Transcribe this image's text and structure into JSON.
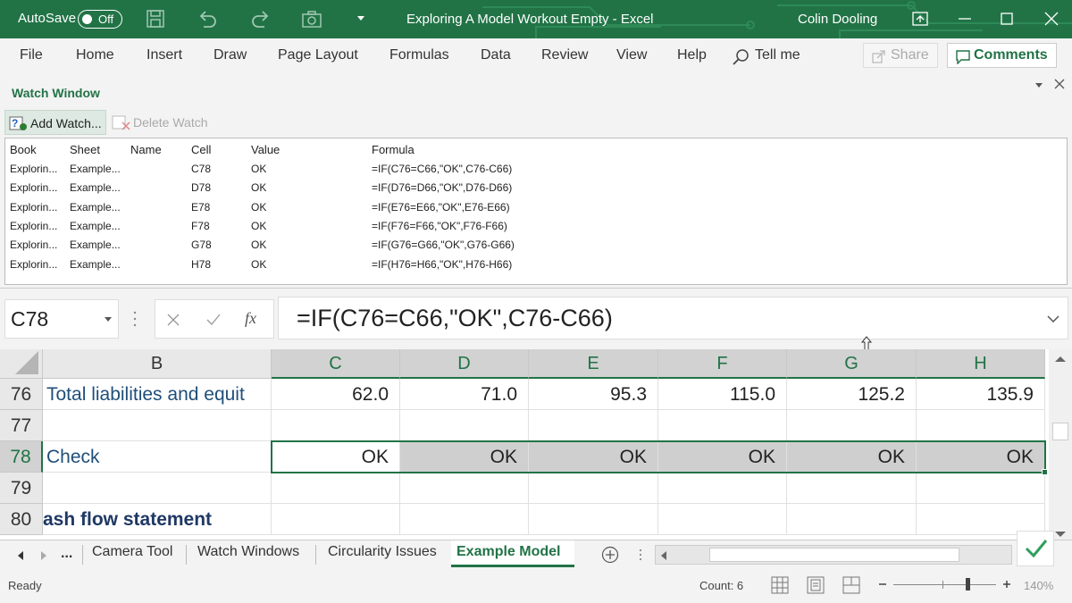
{
  "titlebar": {
    "autosave_label": "AutoSave",
    "autosave_state": "Off",
    "doc_title": "Exploring A Model Workout Empty  -  Excel",
    "user": "Colin Dooling",
    "accent": "#217346"
  },
  "menu": {
    "items": [
      "File",
      "Home",
      "Insert",
      "Draw",
      "Page Layout",
      "Formulas",
      "Data",
      "Review",
      "View",
      "Help",
      "Tell me"
    ],
    "share_label": "Share",
    "comments_label": "Comments"
  },
  "watch": {
    "title": "Watch Window",
    "add_label": "Add Watch...",
    "delete_label": "Delete Watch",
    "headers": [
      "Book",
      "Sheet",
      "Name",
      "Cell",
      "Value",
      "Formula"
    ],
    "rows": [
      [
        "Explorin...",
        "Example...",
        "",
        "C78",
        "OK",
        "=IF(C76=C66,\"OK\",C76-C66)"
      ],
      [
        "Explorin...",
        "Example...",
        "",
        "D78",
        "OK",
        "=IF(D76=D66,\"OK\",D76-D66)"
      ],
      [
        "Explorin...",
        "Example...",
        "",
        "E78",
        "OK",
        "=IF(E76=E66,\"OK\",E76-E66)"
      ],
      [
        "Explorin...",
        "Example...",
        "",
        "F78",
        "OK",
        "=IF(F76=F66,\"OK\",F76-F66)"
      ],
      [
        "Explorin...",
        "Example...",
        "",
        "G78",
        "OK",
        "=IF(G76=G66,\"OK\",G76-G66)"
      ],
      [
        "Explorin...",
        "Example...",
        "",
        "H78",
        "OK",
        "=IF(H76=H66,\"OK\",H76-H66)"
      ]
    ]
  },
  "formula_bar": {
    "name_box": "C78",
    "fx": "fx",
    "formula": "=IF(C76=C66,\"OK\",C76-C66)"
  },
  "grid": {
    "columns": [
      "B",
      "C",
      "D",
      "E",
      "F",
      "G",
      "H"
    ],
    "rows": [
      {
        "num": "76",
        "label": "Total liabilities and equit",
        "values": [
          "62.0",
          "71.0",
          "95.3",
          "115.0",
          "125.2",
          "135.9"
        ]
      },
      {
        "num": "77",
        "label": "",
        "values": [
          "",
          "",
          "",
          "",
          "",
          ""
        ]
      },
      {
        "num": "78",
        "label": "Check",
        "values": [
          "OK",
          "OK",
          "OK",
          "OK",
          "OK",
          "OK"
        ]
      },
      {
        "num": "79",
        "label": "",
        "values": [
          "",
          "",
          "",
          "",
          "",
          ""
        ]
      },
      {
        "num": "80",
        "label": "ash flow statement",
        "values": [
          "",
          "",
          "",
          "",
          "",
          ""
        ]
      }
    ]
  },
  "tabs": {
    "more": "...",
    "items": [
      "Camera Tool",
      "Watch Windows",
      "Circularity Issues",
      "Example Model"
    ],
    "active": "Example Model"
  },
  "status": {
    "ready": "Ready",
    "count": "Count: 6",
    "zoom": "140%"
  }
}
